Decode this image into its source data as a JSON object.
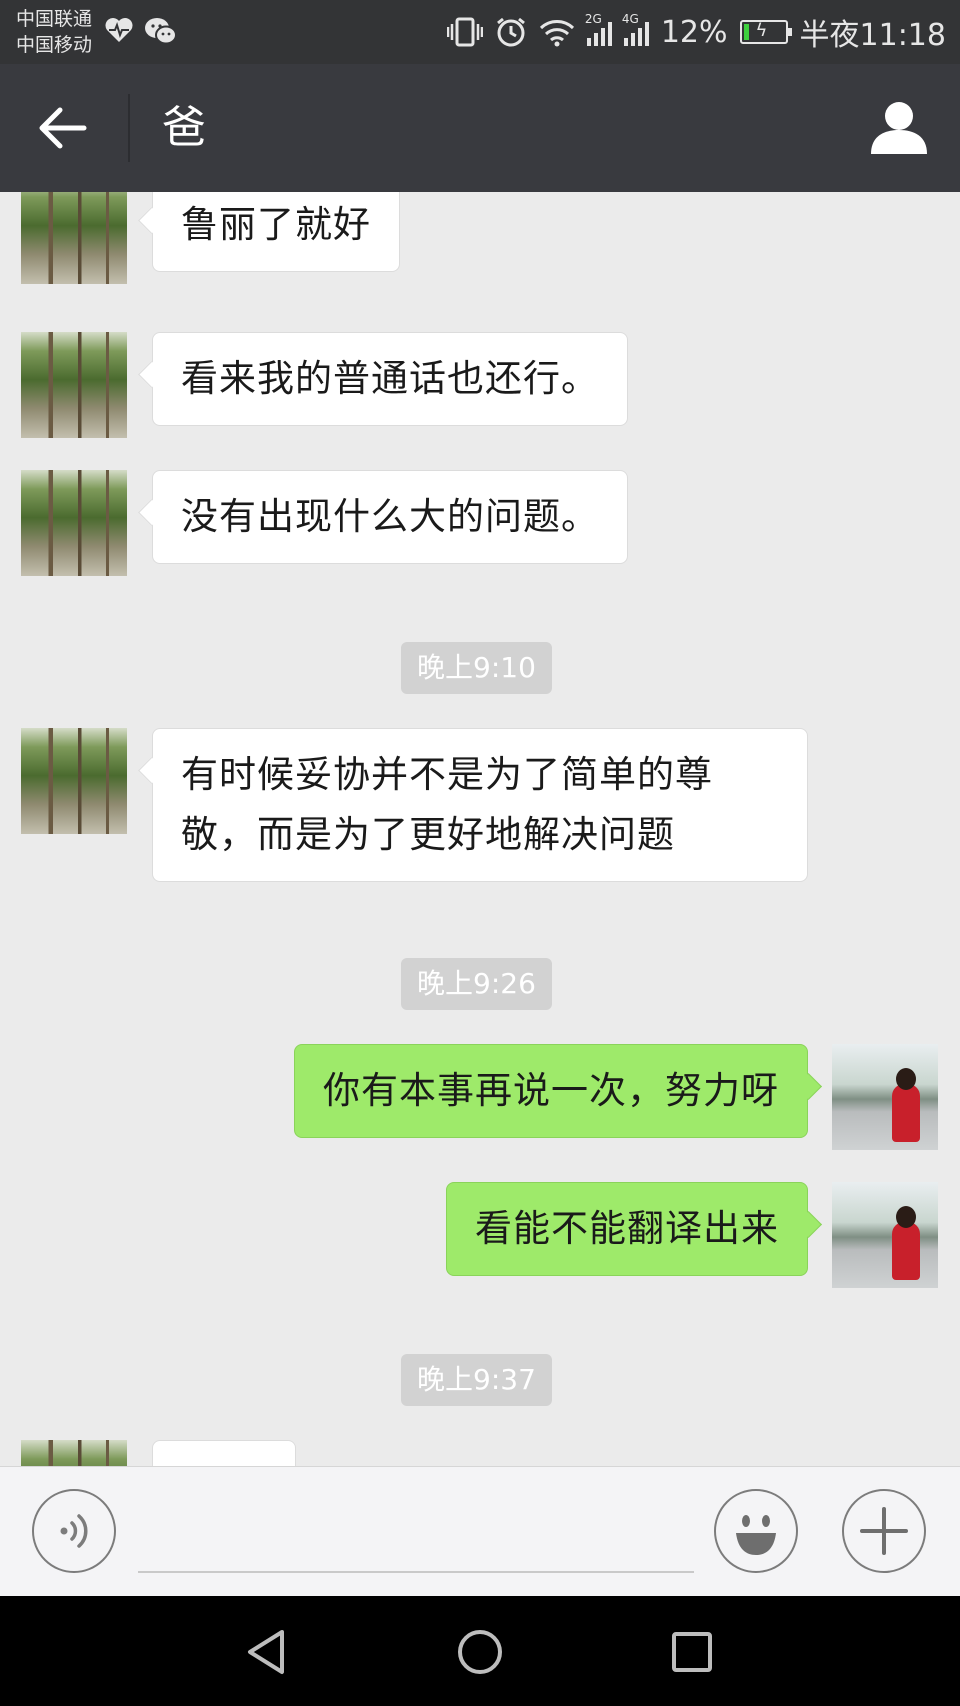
{
  "status_bar": {
    "carrier_1": "中国联通",
    "carrier_2": "中国移动",
    "network_1": "2G",
    "network_2": "4G",
    "battery_percent": "12%",
    "battery_level": 0.12,
    "time": "半夜11:18",
    "icons": [
      "health-heart-icon",
      "wechat-icon",
      "vibrate-icon",
      "alarm-icon",
      "wifi-icon",
      "signal-icon",
      "battery-charging-icon"
    ]
  },
  "nav": {
    "title": "爸",
    "back_icon": "back-arrow-icon",
    "contact_icon": "contact-profile-icon"
  },
  "messages": [
    {
      "side": "left",
      "text": "鲁丽了就好"
    },
    {
      "side": "left",
      "text": "看来我的普通话也还行。"
    },
    {
      "side": "left",
      "text": "没有出现什么大的问题。"
    },
    {
      "time": "晚上9:10"
    },
    {
      "side": "left",
      "text": "有时候妥协并不是为了简单的尊敬，而是为了更好地解决问题",
      "line1": "有时候妥协并不是为了简单的尊",
      "line2": "敬，而是为了更好地解决问题"
    },
    {
      "time": "晚上9:26"
    },
    {
      "side": "right",
      "text": "你有本事再说一次，努力呀"
    },
    {
      "side": "right",
      "text": "看能不能翻译出来"
    },
    {
      "time": "晚上9:37"
    },
    {
      "side": "left",
      "text": ""
    }
  ],
  "input_bar": {
    "voice_icon": "voice-input-icon",
    "emoji_icon": "emoji-icon",
    "plus_icon": "plus-icon",
    "text_value": ""
  },
  "system_nav": {
    "back_icon": "triangle-back-icon",
    "home_icon": "circle-home-icon",
    "recents_icon": "square-recents-icon"
  },
  "colors": {
    "chat_background": "#ebebeb",
    "incoming_bubble": "#ffffff",
    "outgoing_bubble": "#9eea6a",
    "title_bar": "#393a3f",
    "status_bar": "#333436",
    "timestamp_background": "#d2d2d2"
  }
}
